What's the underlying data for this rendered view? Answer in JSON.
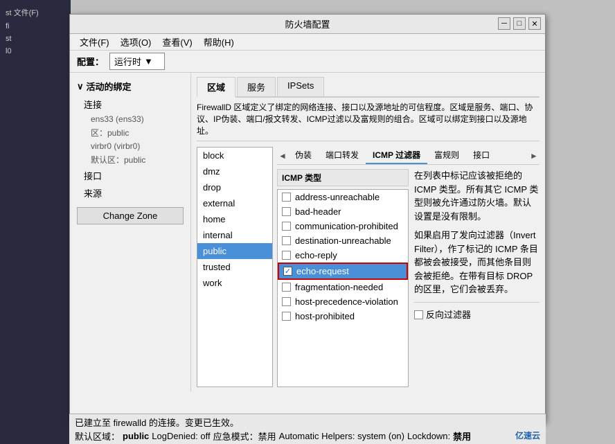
{
  "window": {
    "title": "防火墙配置",
    "minimize_btn": "─",
    "restore_btn": "□",
    "close_btn": "✕"
  },
  "menu": {
    "items": [
      {
        "label": "文件(F)"
      },
      {
        "label": "选项(O)"
      },
      {
        "label": "查看(V)"
      },
      {
        "label": "帮助(H)"
      }
    ]
  },
  "config_bar": {
    "label": "配置：",
    "dropdown_value": "运行时"
  },
  "tabs": {
    "items": [
      {
        "label": "区域"
      },
      {
        "label": "服务"
      },
      {
        "label": "IPSets"
      }
    ],
    "active": 0
  },
  "description": "FirewallD 区域定义了绑定的网络连接、接口以及源地址的可信程度。区域是服务、端口、协议、IP伪装、端口/报文转发、ICMP过滤以及富规则的组合。区域可以绑定到接口以及源地址。",
  "sidebar": {
    "section_label": "活动的绑定",
    "connection_label": "连接",
    "connections": [
      {
        "label": "ens33 (ens33)",
        "sublabel": "区：public"
      },
      {
        "label": "virbr0 (virbr0)",
        "sublabel": "默认区：public"
      }
    ],
    "interface_label": "接口",
    "source_label": "来源",
    "change_zone_btn": "Change Zone"
  },
  "zone_list": {
    "items": [
      {
        "label": "block"
      },
      {
        "label": "dmz"
      },
      {
        "label": "drop"
      },
      {
        "label": "external"
      },
      {
        "label": "home"
      },
      {
        "label": "internal"
      },
      {
        "label": "public"
      },
      {
        "label": "trusted"
      },
      {
        "label": "work"
      }
    ],
    "selected_index": 6
  },
  "icmp_nav": {
    "left_arrow": "◄",
    "right_arrow": "►",
    "tabs": [
      {
        "label": "伪装"
      },
      {
        "label": "端口转发"
      },
      {
        "label": "ICMP 过滤器"
      },
      {
        "label": "富规则"
      },
      {
        "label": "接口"
      }
    ],
    "active": 2
  },
  "icmp_section": {
    "column_label": "ICMP 类型",
    "items": [
      {
        "label": "address-unreachable",
        "checked": false
      },
      {
        "label": "bad-header",
        "checked": false
      },
      {
        "label": "communication-prohibited",
        "checked": false
      },
      {
        "label": "destination-unreachable",
        "checked": false
      },
      {
        "label": "echo-reply",
        "checked": false
      },
      {
        "label": "echo-request",
        "checked": true,
        "selected": true
      },
      {
        "label": "fragmentation-needed",
        "checked": false
      },
      {
        "label": "host-precedence-violation",
        "checked": false
      },
      {
        "label": "host-prohibited",
        "checked": false
      }
    ],
    "right_text_1": "在列表中标记应该被拒绝的 ICMP 类型。所有其它 ICMP 类型则被允许通过防火墙。默认设置是没有限制。",
    "right_text_2": "如果启用了发向过滤器（Invert Filter），作了标记的 ICMP 条目都被会被接受，而其他条目则会被拒绝。在带有目标 DROP 的区里，它们会被丢弃。",
    "invert_filter_label": "反向过滤器"
  },
  "status": {
    "line1": "已建立至 firewalld 的连接。变更已生效。",
    "line2_parts": [
      {
        "text": "默认区域：",
        "bold": false
      },
      {
        "text": "public",
        "bold": true
      },
      {
        "text": "  LogDenied: off",
        "bold": false
      },
      {
        "text": "  应急模式：禁用",
        "bold": false
      },
      {
        "text": "  Automatic Helpers: system (on)",
        "bold": false
      },
      {
        "text": "  Lockdown:",
        "bold": false
      },
      {
        "text": "禁用",
        "bold": true
      }
    ]
  },
  "logo": "亿速云",
  "left_edge_items": [
    {
      "label": "st 文件(F)",
      "highlight": false
    },
    {
      "label": "fi",
      "highlight": false
    },
    {
      "label": "st",
      "highlight": false
    },
    {
      "label": "l0",
      "highlight": false
    }
  ]
}
